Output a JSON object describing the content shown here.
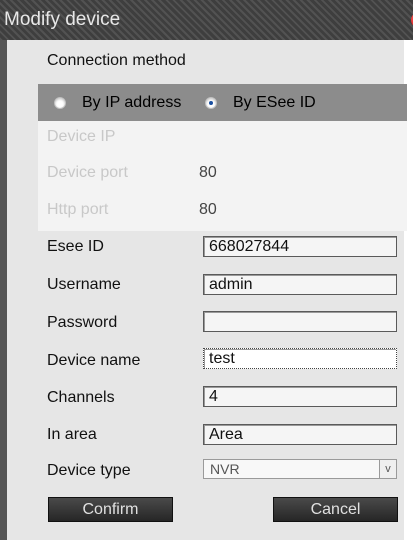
{
  "dialog": {
    "title": "Modify device"
  },
  "connection": {
    "label": "Connection method",
    "options": [
      {
        "label": "By IP address",
        "checked": false
      },
      {
        "label": "By ESee ID",
        "checked": true
      }
    ]
  },
  "disabled_fields": {
    "device_ip": {
      "label": "Device IP",
      "value": ""
    },
    "device_port": {
      "label": "Device port",
      "value": "80"
    },
    "http_port": {
      "label": "Http port",
      "value": "80"
    }
  },
  "fields": {
    "esee_id": {
      "label": "Esee ID",
      "value": "668027844"
    },
    "username": {
      "label": "Username",
      "value": "admin"
    },
    "password": {
      "label": "Password",
      "value": ""
    },
    "device_name": {
      "label": "Device name",
      "value": "test"
    },
    "channels": {
      "label": "Channels",
      "value": "4"
    },
    "in_area": {
      "label": "In area",
      "value": "Area"
    }
  },
  "device_type": {
    "label": "Device type",
    "selected": "NVR",
    "arrow": "v"
  },
  "buttons": {
    "confirm": "Confirm",
    "cancel": "Cancel"
  },
  "colors": {
    "titlebar": "#3e3e3e",
    "dialog_bg": "#e6e6e6",
    "radio_bar": "#8c8c8c",
    "close": "#d40000"
  }
}
